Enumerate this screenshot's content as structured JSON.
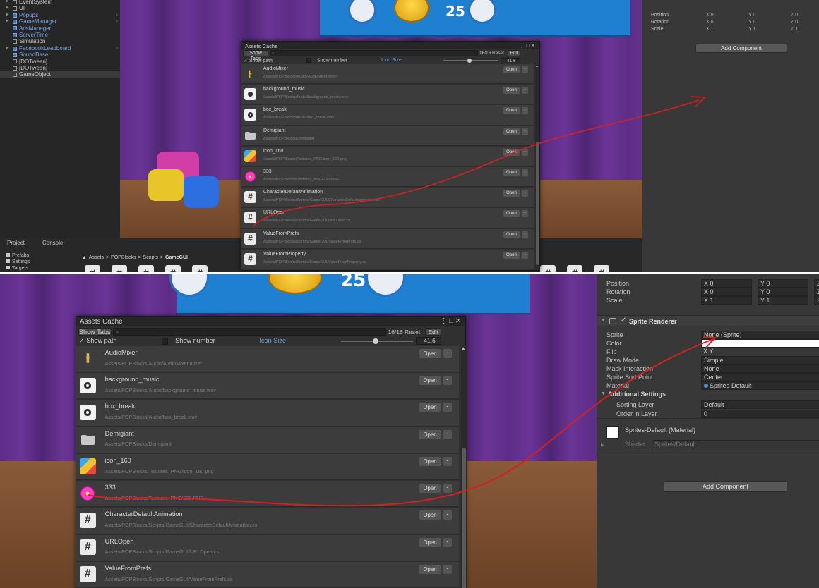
{
  "hierarchy": [
    {
      "label": "EventSystem",
      "prefab": false,
      "expand": true
    },
    {
      "label": "UI",
      "prefab": false,
      "expand": true
    },
    {
      "label": "Popups",
      "prefab": true,
      "expand": true
    },
    {
      "label": "GameManager",
      "prefab": true,
      "expand": true
    },
    {
      "label": "AdsManager",
      "prefab": true,
      "expand": false
    },
    {
      "label": "ServerTime",
      "prefab": true,
      "expand": false
    },
    {
      "label": "Simulation",
      "prefab": false,
      "expand": false
    },
    {
      "label": "FacebookLeadboard",
      "prefab": true,
      "expand": true
    },
    {
      "label": "SoundBase",
      "prefab": true,
      "expand": false
    },
    {
      "label": "[DOTween]",
      "prefab": false,
      "expand": false
    },
    {
      "label": "[DOTween]",
      "prefab": false,
      "expand": false
    },
    {
      "label": "GameObject",
      "prefab": false,
      "expand": false,
      "selected": true
    }
  ],
  "project": {
    "tab_project": "Project",
    "tab_console": "Console",
    "folders": [
      "Prefabs",
      "Settings",
      "Targets"
    ],
    "breadcrumb": [
      "Assets",
      "POPBlocks",
      "Scripts",
      "GameGUI"
    ],
    "breadcrumb_sep": ">"
  },
  "game_ui": {
    "score": "25"
  },
  "assets_cache": {
    "title": "Assets Cache",
    "show_tabs": "Show Tabs",
    "count": "16/16",
    "reset": "Reset",
    "edit": "Edit",
    "show_path": "Show path",
    "show_number": "Show number",
    "icon_size_label": "Icon Size",
    "icon_size_value": "41.6",
    "icon_size_fraction": 0.48,
    "open_label": "Open",
    "remove_label": "-",
    "items": [
      {
        "name": "AudioMixer",
        "path": "Assets/POPBlocks/Audio/AudioMixer.mixer",
        "icon": "mixer"
      },
      {
        "name": "background_music",
        "path": "Assets/POPBlocks/Audio/background_music.wav",
        "icon": "audio"
      },
      {
        "name": "box_break",
        "path": "Assets/POPBlocks/Audio/box_break.wav",
        "icon": "audio"
      },
      {
        "name": "Demigiant",
        "path": "Assets/POPBlocks/Demigiant",
        "icon": "folder"
      },
      {
        "name": "icon_160",
        "path": "Assets/POPBlocks/Textures_PNG/icon_160.png",
        "icon": "game"
      },
      {
        "name": "333",
        "path": "Assets/POPBlocks/Textures_PNG/333.PNG",
        "icon": "flower"
      },
      {
        "name": "CharacterDefaultAnimation",
        "path": "Assets/POPBlocks/Scripts/GameGUI/CharacterDefaultAnimation.cs",
        "icon": "script"
      },
      {
        "name": "URLOpen",
        "path": "Assets/POPBlocks/Scripts/GameGUI/URLOpen.cs",
        "icon": "script"
      },
      {
        "name": "ValueFromPrefs",
        "path": "Assets/POPBlocks/Scripts/GameGUI/ValueFromPrefs.cs",
        "icon": "script"
      },
      {
        "name": "ValueFromProperty",
        "path": "Assets/POPBlocks/Scripts/GameGUI/ValueFromProperty.cs",
        "icon": "script"
      }
    ]
  },
  "inspector": {
    "transform": [
      {
        "label": "Position",
        "x": "0",
        "y": "0",
        "z": "0"
      },
      {
        "label": "Rotation",
        "x": "0",
        "y": "0",
        "z": "0"
      },
      {
        "label": "Scale",
        "x": "1",
        "y": "1",
        "z": "1"
      }
    ],
    "axis_x": "X",
    "axis_y": "Y",
    "axis_z": "Z",
    "add_component": "Add Component",
    "sprite_renderer": {
      "title": "Sprite Renderer",
      "rows": [
        {
          "label": "Sprite",
          "value": "None (Sprite)"
        },
        {
          "label": "Color",
          "value": ""
        },
        {
          "label": "Flip",
          "value": "X    Y"
        },
        {
          "label": "Draw Mode",
          "value": "Simple"
        },
        {
          "label": "Mask Interaction",
          "value": "None"
        },
        {
          "label": "Sprite Sort Point",
          "value": "Center"
        },
        {
          "label": "Material",
          "value": "Sprites-Default"
        }
      ],
      "additional_settings": "Additional Settings",
      "sub_rows": [
        {
          "label": "Sorting Layer",
          "value": "Default"
        },
        {
          "label": "Order in Layer",
          "value": "0"
        }
      ],
      "material_title": "Sprites-Default (Material)",
      "shader_label": "Shader",
      "shader_value": "Sprites/Default"
    }
  },
  "colors": {
    "annotation": "#d42020",
    "panel": "#1f1f1f",
    "inspector": "#383838"
  }
}
